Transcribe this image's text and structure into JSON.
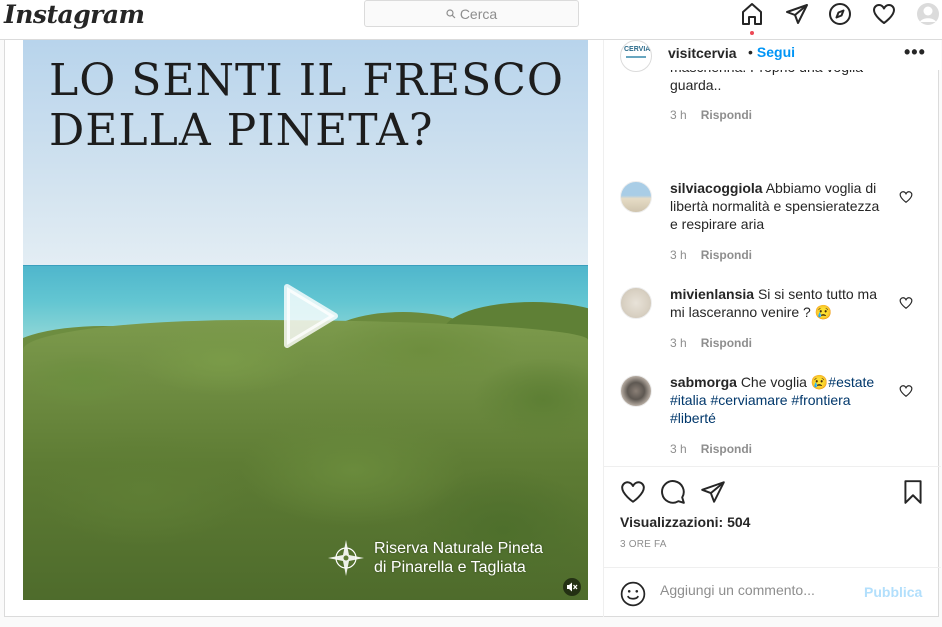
{
  "topbar": {
    "logo": "Instagram",
    "search_placeholder": "Cerca",
    "nav_icons": [
      "home-icon",
      "direct-icon",
      "explore-icon",
      "activity-icon",
      "profile-icon"
    ]
  },
  "media": {
    "headline_line1": "LO SENTI IL FRESCO",
    "headline_line2": "DELLA PINETA?",
    "caption_line1": "Riserva Naturale Pineta",
    "caption_line2": "di Pinarella e Tagliata"
  },
  "post": {
    "username": "visitcervia",
    "follow_label": "Segui",
    "more_label": "•••"
  },
  "comments": [
    {
      "username": "",
      "text": "mascherina. Proprio una voglia guarda..",
      "time": "3 h",
      "reply": "Rispondi"
    },
    {
      "username": "silviacoggiola",
      "text": "Abbiamo voglia di libertà normalità e spensieratezza e respirare aria",
      "time": "3 h",
      "reply": "Rispondi"
    },
    {
      "username": "mivienlansia",
      "text": "Si si sento tutto ma mi lasceranno venire ? 😢",
      "time": "3 h",
      "reply": "Rispondi"
    },
    {
      "username": "sabmorga",
      "text": "Che voglia 😢",
      "tags": [
        "#estate",
        "#italia",
        "#cerviamare",
        "#frontiera",
        "#liberté"
      ],
      "time": "3 h",
      "reply": "Rispondi"
    }
  ],
  "stats": {
    "views": "Visualizzazioni: 504",
    "time_ago": "3 ORE FA"
  },
  "add_comment": {
    "placeholder": "Aggiungi un commento...",
    "publish_label": "Pubblica"
  },
  "colors": {
    "accent": "#0095f6",
    "publish_disabled": "#b2dffc",
    "notification_dot": "#ed4956",
    "hashtag": "#00376b"
  }
}
